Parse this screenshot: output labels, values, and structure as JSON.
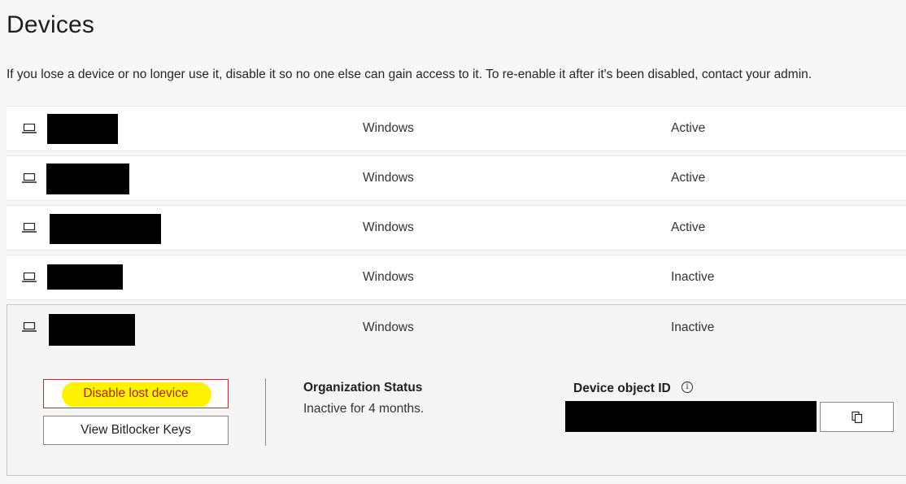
{
  "page": {
    "title": "Devices",
    "description": "If you lose a device or no longer use it, disable it so no one else can gain access to it. To re-enable it after it's been disabled, contact your admin."
  },
  "devices": [
    {
      "name": "[redacted]",
      "os": "Windows",
      "status": "Active",
      "icon": "laptop-icon"
    },
    {
      "name": "[redacted]",
      "os": "Windows",
      "status": "Active",
      "icon": "laptop-icon"
    },
    {
      "name": "[redacted]",
      "os": "Windows",
      "status": "Active",
      "icon": "laptop-icon"
    },
    {
      "name": "[redacted]",
      "os": "Windows",
      "status": "Inactive",
      "icon": "laptop-icon"
    },
    {
      "name": "[redacted]",
      "os": "Windows",
      "status": "Inactive",
      "icon": "laptop-icon",
      "expanded": true
    }
  ],
  "details": {
    "disable_button": "Disable lost device",
    "bitlocker_button": "View Bitlocker Keys",
    "org_status_heading": "Organization Status",
    "org_status_value": "Inactive for 4 months.",
    "device_id_heading": "Device object ID",
    "device_id_value": "[redacted]",
    "info_icon": "info-icon",
    "copy_icon": "copy-icon"
  },
  "colors": {
    "danger_border": "#a4373a",
    "highlight": "#fff200",
    "row_background": "#ffffff",
    "page_background": "#f7f7f7"
  }
}
